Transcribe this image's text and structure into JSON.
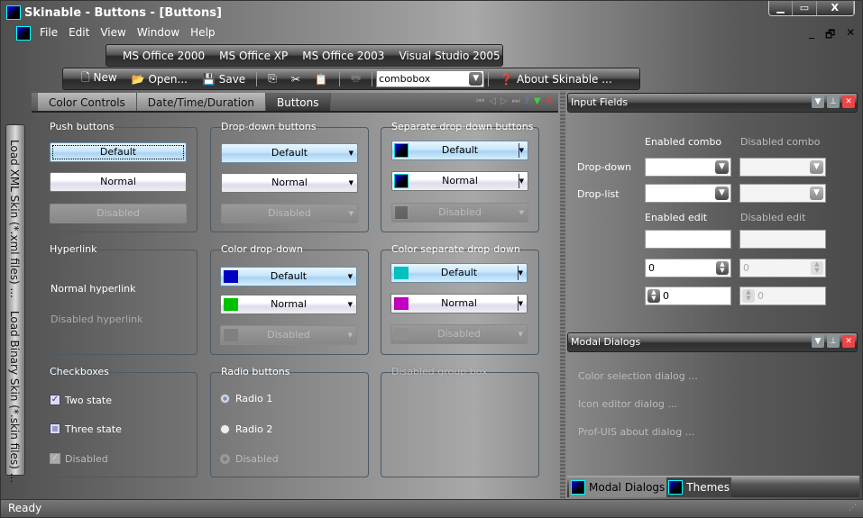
{
  "window": {
    "title": "Skinable - Buttons - [Buttons]",
    "caption_buttons": [
      "minimize",
      "maximize",
      "close"
    ]
  },
  "menu": {
    "items": [
      "File",
      "Edit",
      "View",
      "Window",
      "Help"
    ],
    "mdi_buttons": [
      "_",
      "🗗",
      "✕"
    ]
  },
  "themes_toolbar": {
    "items": [
      "MS Office 2000",
      "MS Office XP",
      "MS Office 2003",
      "Visual Studio 2005"
    ]
  },
  "standard_toolbar": {
    "new": "New",
    "open": "Open...",
    "save": "Save",
    "combo_value": "combobox",
    "about": "About Skinable ..."
  },
  "tabs": {
    "items": [
      "Color Controls",
      "Date/Time/Duration",
      "Buttons"
    ],
    "active": "Buttons"
  },
  "left_bar": {
    "load_xml": "Load XML Skin (*.xml files) ...",
    "load_binary": "Load Binary Skin (*.skin files) ..."
  },
  "groups": {
    "push": {
      "title": "Push buttons",
      "default": "Default",
      "normal": "Normal",
      "disabled": "Disabled"
    },
    "dropdown": {
      "title": "Drop-down buttons",
      "default": "Default",
      "normal": "Normal",
      "disabled": "Disabled"
    },
    "separate": {
      "title": "Separate drop-down buttons",
      "default": "Default",
      "normal": "Normal",
      "disabled": "Disabled"
    },
    "hyperlink": {
      "title": "Hyperlink",
      "normal": "Normal hyperlink",
      "disabled": "Disabled hyperlink"
    },
    "color_dropdown": {
      "title": "Color drop-down",
      "default": "Default",
      "normal": "Normal",
      "disabled": "Disabled",
      "colors": [
        "#0000c0",
        "#00c000",
        "#808080"
      ]
    },
    "color_separate": {
      "title": "Color separate drop-down",
      "default": "Default",
      "normal": "Normal",
      "disabled": "Disabled",
      "colors": [
        "#00c0c0",
        "#c000c0",
        "#909090"
      ]
    },
    "checkboxes": {
      "title": "Checkboxes",
      "two_state": "Two state",
      "three_state": "Three state",
      "disabled": "Disabled"
    },
    "radio": {
      "title": "Radio buttons",
      "radio1": "Radio 1",
      "radio2": "Radio 2",
      "disabled": "Disabled"
    },
    "disabled_group": {
      "title": "Disabled group box"
    }
  },
  "input_fields": {
    "title": "Input Fields",
    "enabled_combo": "Enabled combo",
    "disabled_combo": "Disabled combo",
    "drop_down": "Drop-down",
    "drop_list": "Drop-list",
    "enabled_edit": "Enabled edit",
    "disabled_edit": "Disabled edit",
    "spin_value": "0"
  },
  "modal_dialogs": {
    "title": "Modal Dialogs",
    "items": [
      "Color selection dialog ...",
      "Icon editor dialog ...",
      "Prof-UIS about dialog ..."
    ]
  },
  "bottom_tabs": [
    "Modal Dialogs",
    "Themes"
  ],
  "status": {
    "text": "Ready"
  }
}
